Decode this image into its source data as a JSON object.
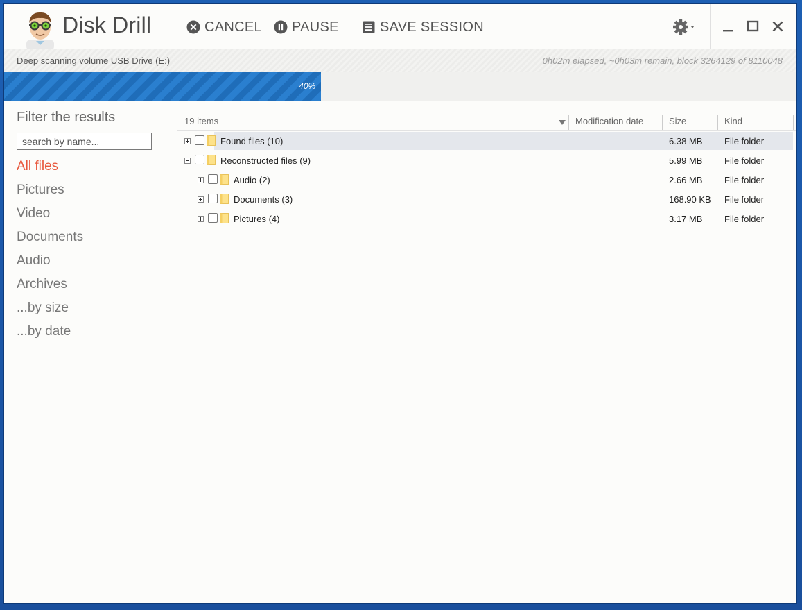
{
  "app": {
    "title": "Disk Drill"
  },
  "toolbar": {
    "cancel_label": "CANCEL",
    "pause_label": "PAUSE",
    "save_session_label": "SAVE SESSION"
  },
  "status": {
    "left": "Deep scanning volume USB Drive (E:)",
    "right": "0h02m elapsed, ~0h03m remain, block 3264129 of 8110048"
  },
  "progress": {
    "percent_label": "40%",
    "fraction": 0.4,
    "color": "#2a7fcf"
  },
  "sidebar": {
    "title": "Filter the results",
    "search_placeholder": "search by name...",
    "categories": [
      {
        "label": "All files",
        "active": true
      },
      {
        "label": "Pictures"
      },
      {
        "label": "Video"
      },
      {
        "label": "Documents"
      },
      {
        "label": "Audio"
      },
      {
        "label": "Archives"
      },
      {
        "label": "...by size"
      },
      {
        "label": "...by date"
      }
    ],
    "active_color": "#e8573c"
  },
  "table": {
    "count_label": "19 items",
    "columns": {
      "modified": "Modification date",
      "size": "Size",
      "kind": "Kind"
    },
    "rows": [
      {
        "name": "Found files",
        "count": "(10)",
        "size": "6.38 MB",
        "kind": "File folder",
        "level": 0,
        "expanded": false,
        "selected": true
      },
      {
        "name": "Reconstructed files",
        "count": "(9)",
        "size": "5.99 MB",
        "kind": "File folder",
        "level": 0,
        "expanded": true
      },
      {
        "name": "Audio",
        "count": "(2)",
        "size": "2.66 MB",
        "kind": "File folder",
        "level": 1,
        "expanded": false
      },
      {
        "name": "Documents",
        "count": "(3)",
        "size": "168.90 KB",
        "kind": "File folder",
        "level": 1,
        "expanded": false
      },
      {
        "name": "Pictures",
        "count": "(4)",
        "size": "3.17 MB",
        "kind": "File folder",
        "level": 1,
        "expanded": false
      }
    ]
  }
}
